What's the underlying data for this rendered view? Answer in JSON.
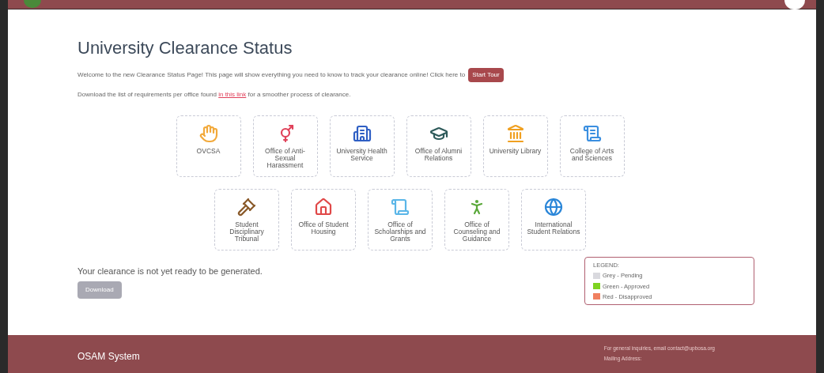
{
  "header": {
    "title": "University Clearance Status"
  },
  "intro": {
    "text": "Welcome to the new Clearance Status Page! This page will show everything you need to know to track your clearance online! Click here to",
    "tour_button": "Start Tour"
  },
  "download_note": {
    "before": "Download the list of requirements per office found",
    "link": "in this link",
    "after": "for a smoother process of clearance."
  },
  "offices": [
    {
      "name": "OVCSA"
    },
    {
      "name": "Office of Anti-Sexual Harassment"
    },
    {
      "name": "University Health Service"
    },
    {
      "name": "Office of Alumni Relations"
    },
    {
      "name": "University Library"
    },
    {
      "name": "College of Arts and Sciences"
    },
    {
      "name": "Student Disciplinary Tribunal"
    },
    {
      "name": "Office of Student Housing"
    },
    {
      "name": "Office of Scholarships and Grants"
    },
    {
      "name": "Office of Counseling and Guidance"
    },
    {
      "name": "International Student Relations"
    }
  ],
  "clearance": {
    "message": "Your clearance is not yet ready to be generated.",
    "download_button": "Download",
    "disabled": true
  },
  "legend": {
    "title": "LEGEND:",
    "items": [
      {
        "label": "Grey - Pending",
        "color": "#d9d9de"
      },
      {
        "label": "Green - Approved",
        "color": "#7ed321"
      },
      {
        "label": "Red - Disapproved",
        "color": "#f08060"
      }
    ]
  },
  "footer": {
    "brand": "OSAM System",
    "inquiry": "For general inquiries, email contact@upbosa.org",
    "mailing_label": "Mailing Address:"
  }
}
